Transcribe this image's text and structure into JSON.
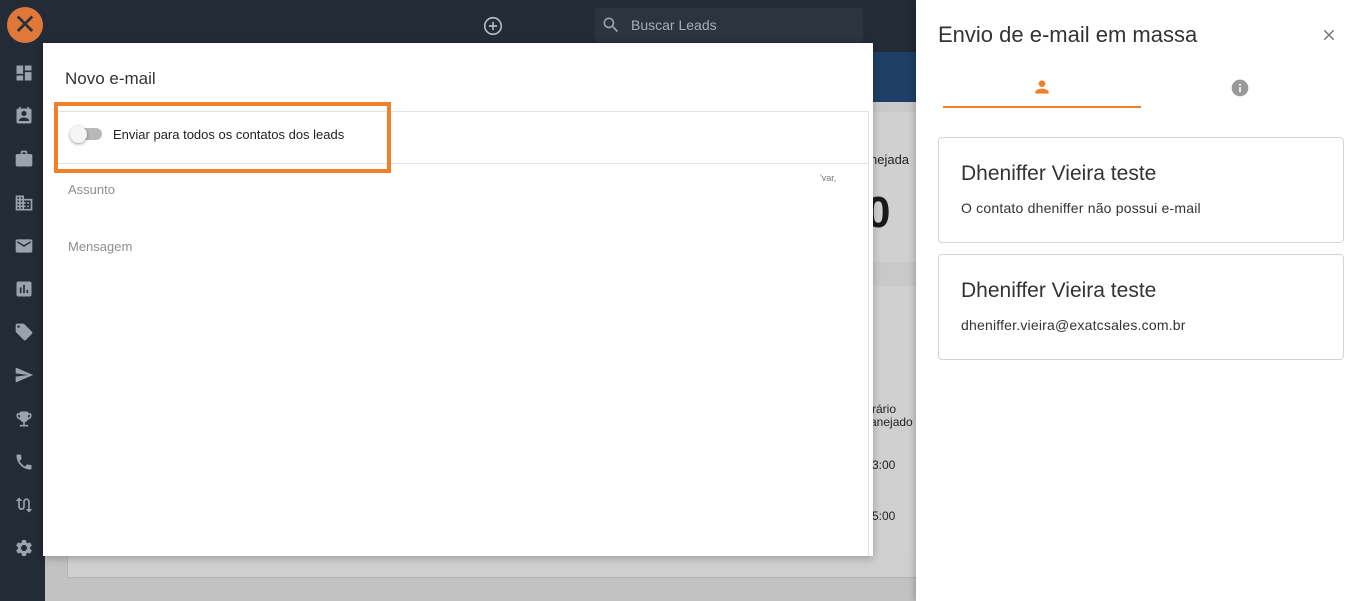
{
  "app": {
    "logo_glyph": "✕"
  },
  "sidebar": {
    "items": [
      {
        "name": "dashboard-icon"
      },
      {
        "name": "contacts-icon"
      },
      {
        "name": "briefcase-icon"
      },
      {
        "name": "building-icon"
      },
      {
        "name": "mail-icon"
      },
      {
        "name": "bar-chart-icon"
      },
      {
        "name": "tag-icon"
      },
      {
        "name": "send-icon"
      },
      {
        "name": "trophy-icon"
      },
      {
        "name": "phone-icon"
      },
      {
        "name": "route-icon"
      },
      {
        "name": "gear-icon"
      }
    ]
  },
  "topbar": {
    "search_placeholder": "Buscar Leads"
  },
  "background": {
    "label_planejada": "nejada",
    "big_value": "0",
    "label_horario": "rário",
    "label_planejado": "anejado",
    "time1": "3:00",
    "time2": "5:00"
  },
  "modal": {
    "title": "Novo e-mail",
    "toggle_label": "Enviar para todos os contatos dos leads",
    "subject_label": "Assunto",
    "message_label": "Mensagem",
    "var_hint": "'var,"
  },
  "panel": {
    "title": "Envio de e-mail em massa",
    "contacts": [
      {
        "name": "Dheniffer Vieira teste",
        "detail": "O contato dheniffer não possui e-mail"
      },
      {
        "name": "Dheniffer Vieira teste",
        "detail": "dheniffer.vieira@exatcsales.com.br"
      }
    ]
  },
  "colors": {
    "accent": "#f0812b",
    "sidebar_bg": "#232b36"
  }
}
